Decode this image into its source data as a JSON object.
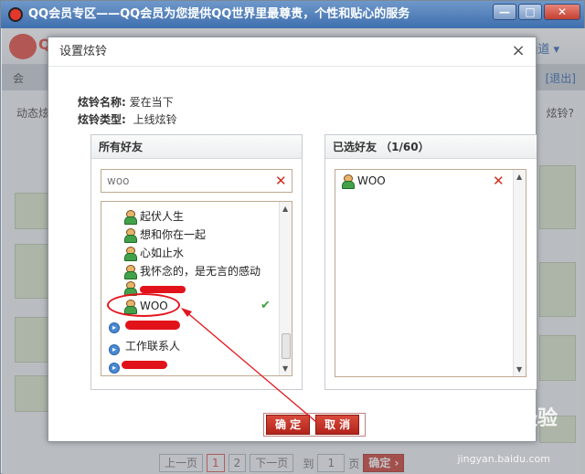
{
  "window": {
    "title": "QQ会员专区——QQ会员为您提供QQ世界里最尊贵，个性和贴心的服务",
    "min_label": "—",
    "max_label": "□",
    "close_label": "✕"
  },
  "background": {
    "logo_text": "Q",
    "channel": "通道 ▾",
    "nav_home": "会",
    "exit": "[退出]",
    "line_left": "动态炫",
    "line_right": "炫铃?",
    "pager": {
      "prev": "上一页",
      "pages": [
        "1",
        "2"
      ],
      "next": "下一页",
      "goto": "到",
      "page_value": "1",
      "page_suffix": "页",
      "ok": "确定 ›"
    }
  },
  "dialog": {
    "title": "设置炫铃",
    "close_label": "×",
    "ring_name_label": "炫铃名称:",
    "ring_name": "爱在当下",
    "ring_type_label": "炫铃类型:",
    "ring_type": "上线炫铃",
    "all_friends": {
      "header": "所有好友",
      "search_value": "woo",
      "items": [
        {
          "type": "person",
          "label": "起伏人生"
        },
        {
          "type": "person",
          "label": "想和你在一起"
        },
        {
          "type": "person",
          "label": "心如止水"
        },
        {
          "type": "person",
          "label": "我怀念的，是无言的感动"
        },
        {
          "type": "person",
          "label": ""
        },
        {
          "type": "person",
          "label": "WOO",
          "checked": true
        },
        {
          "type": "group",
          "label": ""
        },
        {
          "type": "group",
          "label": "工作联系人"
        },
        {
          "type": "group",
          "label": ""
        }
      ],
      "check_mark": "✔"
    },
    "selected_friends": {
      "header": "已选好友 （1/60）",
      "items": [
        {
          "type": "person",
          "label": "WOO"
        }
      ]
    },
    "confirm_label": "确 定",
    "cancel_label": "取 消"
  },
  "watermark": {
    "main": "Bai 经验",
    "sub": "jingyan.baidu.com"
  }
}
